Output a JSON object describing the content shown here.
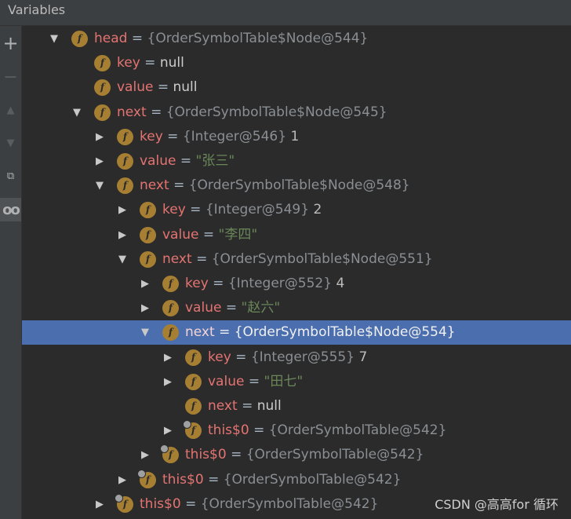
{
  "panel": {
    "title": "Variables",
    "watermark": "CSDN @高高for 循环"
  },
  "toolbar": {
    "buttons": [
      {
        "name": "add-watch-button",
        "glyph": "+"
      },
      {
        "name": "remove-watch-button",
        "glyph": "−"
      },
      {
        "name": "move-up-button",
        "glyph": "▲"
      },
      {
        "name": "move-down-button",
        "glyph": "▼"
      },
      {
        "name": "copy-button",
        "glyph": "⧉"
      },
      {
        "name": "show-watches-button",
        "glyph": "oo"
      }
    ]
  },
  "tree": {
    "rows": [
      {
        "n": "head",
        "eq": "=",
        "ref": "{OrderSymbolTable$Node@544}",
        "val": "",
        "vt": "",
        "depth": 0,
        "exp": "expanded",
        "syn": false,
        "sel": false
      },
      {
        "n": "key",
        "eq": "=",
        "ref": "",
        "val": "null",
        "vt": "nul",
        "depth": 1,
        "exp": "none",
        "syn": false,
        "sel": false
      },
      {
        "n": "value",
        "eq": "=",
        "ref": "",
        "val": "null",
        "vt": "nul",
        "depth": 1,
        "exp": "none",
        "syn": false,
        "sel": false
      },
      {
        "n": "next",
        "eq": "=",
        "ref": "{OrderSymbolTable$Node@545}",
        "val": "",
        "vt": "",
        "depth": 1,
        "exp": "expanded",
        "syn": false,
        "sel": false
      },
      {
        "n": "key",
        "eq": "=",
        "ref": "{Integer@546}",
        "val": "1",
        "vt": "num",
        "depth": 2,
        "exp": "collapsed",
        "syn": false,
        "sel": false
      },
      {
        "n": "value",
        "eq": "=",
        "ref": "",
        "val": "\"张三\"",
        "vt": "str",
        "depth": 2,
        "exp": "collapsed",
        "syn": false,
        "sel": false
      },
      {
        "n": "next",
        "eq": "=",
        "ref": "{OrderSymbolTable$Node@548}",
        "val": "",
        "vt": "",
        "depth": 2,
        "exp": "expanded",
        "syn": false,
        "sel": false
      },
      {
        "n": "key",
        "eq": "=",
        "ref": "{Integer@549}",
        "val": "2",
        "vt": "num",
        "depth": 3,
        "exp": "collapsed",
        "syn": false,
        "sel": false
      },
      {
        "n": "value",
        "eq": "=",
        "ref": "",
        "val": "\"李四\"",
        "vt": "str",
        "depth": 3,
        "exp": "collapsed",
        "syn": false,
        "sel": false
      },
      {
        "n": "next",
        "eq": "=",
        "ref": "{OrderSymbolTable$Node@551}",
        "val": "",
        "vt": "",
        "depth": 3,
        "exp": "expanded",
        "syn": false,
        "sel": false
      },
      {
        "n": "key",
        "eq": "=",
        "ref": "{Integer@552}",
        "val": "4",
        "vt": "num",
        "depth": 4,
        "exp": "collapsed",
        "syn": false,
        "sel": false
      },
      {
        "n": "value",
        "eq": "=",
        "ref": "",
        "val": "\"赵六\"",
        "vt": "str",
        "depth": 4,
        "exp": "collapsed",
        "syn": false,
        "sel": false
      },
      {
        "n": "next",
        "eq": "=",
        "ref": "{OrderSymbolTable$Node@554}",
        "val": "",
        "vt": "",
        "depth": 4,
        "exp": "expanded",
        "syn": false,
        "sel": true
      },
      {
        "n": "key",
        "eq": "=",
        "ref": "{Integer@555}",
        "val": "7",
        "vt": "num",
        "depth": 5,
        "exp": "collapsed",
        "syn": false,
        "sel": false
      },
      {
        "n": "value",
        "eq": "=",
        "ref": "",
        "val": "\"田七\"",
        "vt": "str",
        "depth": 5,
        "exp": "collapsed",
        "syn": false,
        "sel": false
      },
      {
        "n": "next",
        "eq": "=",
        "ref": "",
        "val": "null",
        "vt": "nul",
        "depth": 5,
        "exp": "none",
        "syn": false,
        "sel": false
      },
      {
        "n": "this$0",
        "eq": "=",
        "ref": "{OrderSymbolTable@542}",
        "val": "",
        "vt": "",
        "depth": 5,
        "exp": "collapsed",
        "syn": true,
        "sel": false
      },
      {
        "n": "this$0",
        "eq": "=",
        "ref": "{OrderSymbolTable@542}",
        "val": "",
        "vt": "",
        "depth": 4,
        "exp": "collapsed",
        "syn": true,
        "sel": false
      },
      {
        "n": "this$0",
        "eq": "=",
        "ref": "{OrderSymbolTable@542}",
        "val": "",
        "vt": "",
        "depth": 3,
        "exp": "collapsed",
        "syn": true,
        "sel": false
      },
      {
        "n": "this$0",
        "eq": "=",
        "ref": "{OrderSymbolTable@542}",
        "val": "",
        "vt": "",
        "depth": 2,
        "exp": "collapsed",
        "syn": true,
        "sel": false
      }
    ]
  },
  "colors": {
    "background": "#2b2b2b",
    "selection": "#4b6eaf",
    "field_badge": "#a67f33",
    "var_name": "#e47472",
    "string_value": "#6a8759"
  },
  "icons": {
    "field": "field-f-icon",
    "expanded": "triangle-down-icon",
    "collapsed": "triangle-right-icon"
  }
}
